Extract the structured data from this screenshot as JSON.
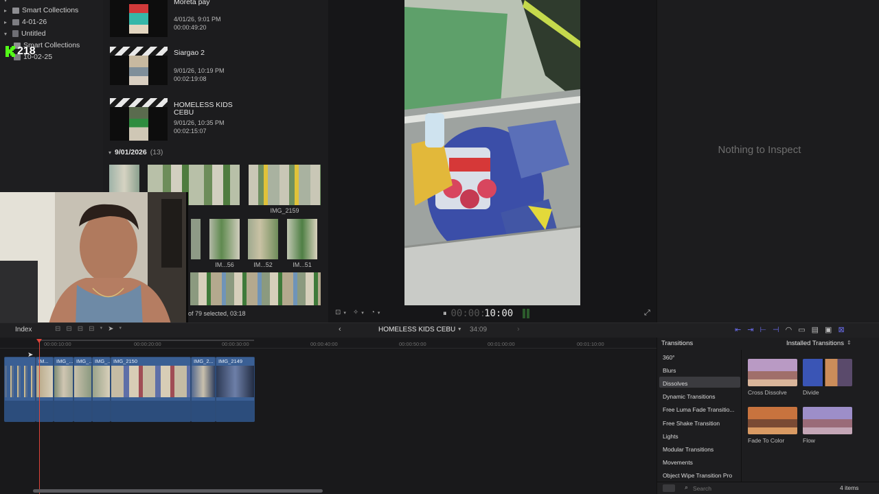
{
  "library": {
    "items": [
      {
        "label": "Smart Collections",
        "icon": "folder-icon"
      },
      {
        "label": "4-01-26",
        "icon": "event-icon"
      },
      {
        "label": "Untitled",
        "icon": "library-icon"
      },
      {
        "label": "Smart Collections",
        "icon": "folder-icon"
      },
      {
        "label": "10-02-25",
        "icon": "event-icon"
      }
    ],
    "overlay_badge": "218"
  },
  "browser": {
    "projects": [
      {
        "title": "Moreta pay",
        "date": "4/01/26, 9:01 PM",
        "duration": "00:00:49:20"
      },
      {
        "title": "Siargao 2",
        "date": "9/01/26, 10:19 PM",
        "duration": "00:02:19:08"
      },
      {
        "title": "HOMELESS KIDS CEBU",
        "date": "9/01/26, 10:35 PM",
        "duration": "00:02:15:07"
      }
    ],
    "date_group": "9/01/2026",
    "date_group_count": "(13)",
    "clip_labels": [
      "IMG_2159",
      "IM...56",
      "IM...52",
      "IM...51"
    ],
    "selection_status": "of 79 selected, 03:18"
  },
  "viewer": {
    "timecode_dim": "00:00:",
    "timecode": "10:00"
  },
  "inspector": {
    "empty_text": "Nothing to Inspect"
  },
  "toolbar": {
    "index_label": "Index",
    "project_name": "HOMELESS KIDS CEBU",
    "project_duration": "34:09"
  },
  "timeline": {
    "ruler": [
      "00:00:10:00",
      "00:00:20:00",
      "00:00:30:00",
      "00:00:40:00",
      "00:00:50:00",
      "00:01:00:00",
      "00:01:10:00"
    ],
    "clips": [
      "IMG_...",
      "IMG_...",
      "IMG_...",
      "IMG_2150",
      "IMG_2...",
      "IMG_2149"
    ]
  },
  "transitions": {
    "header": "Transitions",
    "source": "Installed Transitions",
    "categories": [
      "360°",
      "Blurs",
      "Dissolves",
      "Dynamic Transitions",
      "Free Luma Fade Transitio...",
      "Free Shake Transition",
      "Lights",
      "Modular Transitions",
      "Movements",
      "Object Wipe Transition Pro"
    ],
    "selected_category": "Dissolves",
    "items": [
      "Cross Dissolve",
      "Divide",
      "Fade To Color",
      "Flow"
    ],
    "search_placeholder": "Search",
    "count": "4 items"
  },
  "colors": {
    "accent_purple": "#6b6ef0",
    "clip_blue": "#3a5f94",
    "playhead_red": "#e0443a"
  }
}
